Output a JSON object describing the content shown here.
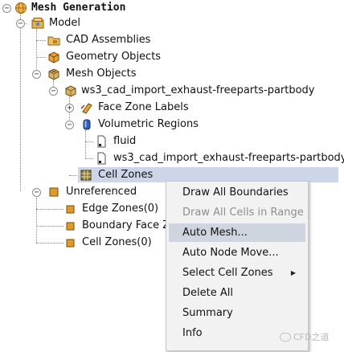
{
  "tree": {
    "root_label": "Mesh Generation",
    "model_label": "Model",
    "cad_assemblies_label": "CAD Assemblies",
    "geometry_objects_label": "Geometry Objects",
    "mesh_objects_label": "Mesh Objects",
    "part_label": "ws3_cad_import_exhaust-freeparts-partbody",
    "face_zone_labels_label": "Face Zone Labels",
    "volumetric_regions_label": "Volumetric Regions",
    "fluid_label": "fluid",
    "region_part_label": "ws3_cad_import_exhaust-freeparts-partbody",
    "cell_zones_label": "Cell Zones",
    "unreferenced_label": "Unreferenced",
    "edge_zones_label": "Edge Zones(0)",
    "boundary_face_label": "Boundary Face Z",
    "cell_zones_count_label": "Cell Zones(0)"
  },
  "context_menu": {
    "items": [
      {
        "label": "Draw All Boundaries",
        "enabled": true
      },
      {
        "label": "Draw All Cells in Range",
        "enabled": false
      },
      {
        "label": "Auto Mesh...",
        "enabled": true,
        "highlighted": true
      },
      {
        "label": "Auto Node Move...",
        "enabled": true
      },
      {
        "label": "Select Cell Zones",
        "enabled": true,
        "submenu": true
      },
      {
        "label": "Delete All",
        "enabled": true
      },
      {
        "label": "Summary",
        "enabled": true
      },
      {
        "label": "Info",
        "enabled": true
      }
    ],
    "submenu_arrow": "▶"
  },
  "watermark": {
    "text": "CFD之道"
  },
  "colors": {
    "selection": "#ccd6e8",
    "menu_bg": "#f2f2f2",
    "menu_hover": "#cfd5df",
    "disabled_text": "#8e8e8e"
  }
}
